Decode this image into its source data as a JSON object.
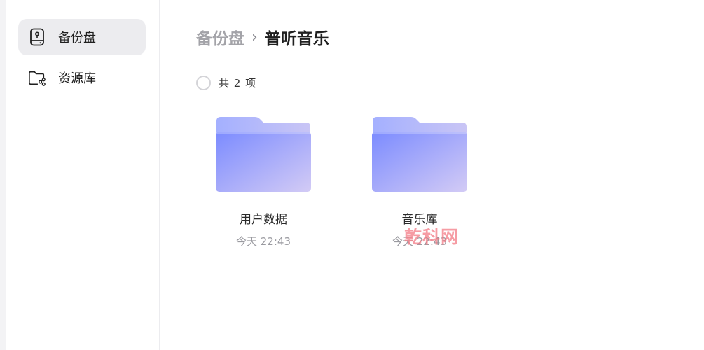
{
  "sidebar": {
    "items": [
      {
        "label": "备份盘",
        "icon": "backup-drive-icon",
        "active": true
      },
      {
        "label": "资源库",
        "icon": "shared-folder-icon",
        "active": false
      }
    ]
  },
  "breadcrumb": {
    "parent": "备份盘",
    "separator": "›",
    "current": "普听音乐"
  },
  "selection": {
    "count_text": "共 2 项"
  },
  "folders": [
    {
      "name": "用户数据",
      "time": "今天 22:43"
    },
    {
      "name": "音乐库",
      "time": "今天 22:43"
    }
  ],
  "watermark": "乾科网",
  "colors": {
    "folder_gradient_start": "#7b8bff",
    "folder_gradient_end": "#d3cbf5",
    "active_bg": "#ececef",
    "watermark": "#f47b86"
  }
}
